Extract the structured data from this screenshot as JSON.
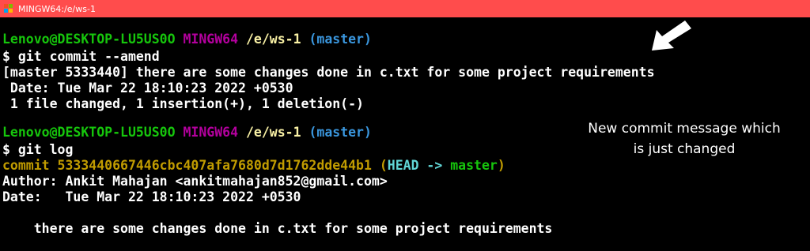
{
  "window": {
    "title": "MINGW64:/e/ws-1"
  },
  "terminal": {
    "prompt1": {
      "user_host": "Lenovo@DESKTOP-LU5US0O",
      "env": "MINGW64",
      "path": "/e/ws-1",
      "branch": "(master)"
    },
    "cmd1": "$ git commit --amend",
    "commit_summary": "[master 5333440] there are some changes done in c.txt for some project requirements",
    "commit_date": " Date: Tue Mar 22 18:10:23 2022 +0530",
    "commit_stats": " 1 file changed, 1 insertion(+), 1 deletion(-)",
    "prompt2": {
      "user_host": "Lenovo@DESKTOP-LU5US0O",
      "env": "MINGW64",
      "path": "/e/ws-1",
      "branch": "(master)"
    },
    "cmd2": "$ git log",
    "log": {
      "commit_prefix": "commit 5333440667446cbc407afa7680d7d1762dde44b1 (",
      "head": "HEAD -> ",
      "master": "master",
      "close": ")",
      "author": "Author: Ankit Mahajan <ankitmahajan852@gmail.com>",
      "date": "Date:   Tue Mar 22 18:10:23 2022 +0530",
      "message": "    there are some changes done in c.txt for some project requirements"
    }
  },
  "annotation": {
    "line1": "New commit message which",
    "line2": "is just changed"
  },
  "colors": {
    "titlebar": "#ff4c4c",
    "prompt_green": "#16c60c",
    "env_magenta": "#b4009e",
    "path_yellow": "#f9f1a5",
    "branch_cyan": "#3a96dd",
    "commit_yellow": "#c19c00"
  }
}
